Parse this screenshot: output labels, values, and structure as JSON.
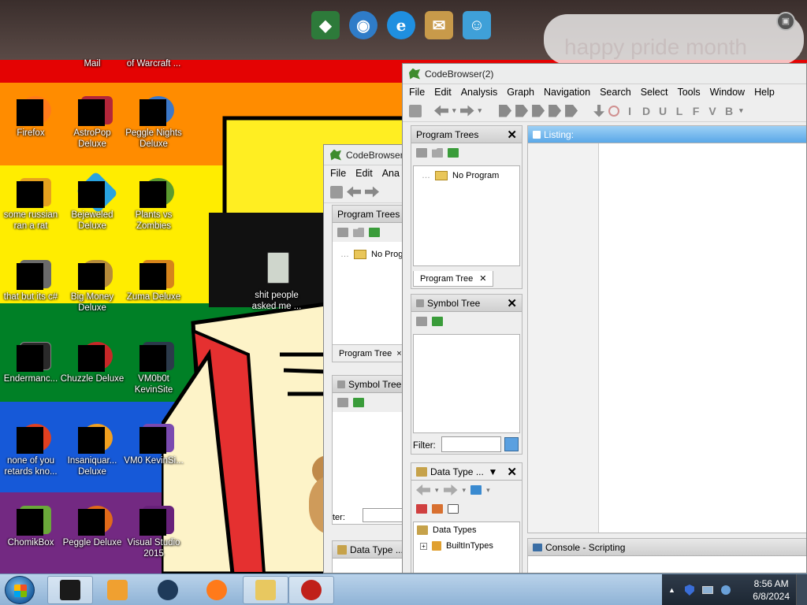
{
  "desktop": {
    "banner_text": "happy pride month",
    "top_labels": [
      {
        "text": "Mail"
      },
      {
        "text": "of Warcraft ..."
      }
    ],
    "icons": [
      {
        "name": "firefox",
        "label": "Firefox",
        "color": "#ff7a1a"
      },
      {
        "name": "astropop",
        "label": "AstroPop Deluxe",
        "color": "#b3263a"
      },
      {
        "name": "peggle-nights",
        "label": "Peggle Nights Deluxe",
        "color": "#3c78c8"
      },
      {
        "name": "some-russian",
        "label": "some russian ran a rat",
        "color": "#e7a21e"
      },
      {
        "name": "bejeweled",
        "label": "Bejeweled Deluxe",
        "color": "#29a3e0"
      },
      {
        "name": "plants-vs-zombies",
        "label": "Plants vs Zombies",
        "color": "#5b9a2e"
      },
      {
        "name": "that-but-its-csharp",
        "label": "that but its c#",
        "color": "#6a6a6a"
      },
      {
        "name": "big-money",
        "label": "Big Money Deluxe",
        "color": "#b58b3a"
      },
      {
        "name": "zuma",
        "label": "Zuma Deluxe",
        "color": "#d6841b"
      },
      {
        "name": "endermanch",
        "label": "Endermanc...",
        "color": "#2a2a2a"
      },
      {
        "name": "chuzzle",
        "label": "Chuzzle Deluxe",
        "color": "#c62828"
      },
      {
        "name": "vm0b0t-kevinsite",
        "label": "VM0b0t KevinSite",
        "color": "#2b3a4a"
      },
      {
        "name": "none-of-you",
        "label": "none of you retards kno...",
        "color": "#e04020"
      },
      {
        "name": "insaniquarium",
        "label": "Insaniquar... Deluxe",
        "color": "#f0a020"
      },
      {
        "name": "vm0-kevinsite",
        "label": "VM0 KevinSi...",
        "color": "#7a4ab0"
      },
      {
        "name": "chomikbox",
        "label": "ChomikBox",
        "color": "#6aa83a"
      },
      {
        "name": "peggle-deluxe",
        "label": "Peggle Deluxe",
        "color": "#e06a1a"
      },
      {
        "name": "visual-studio-2015",
        "label": "Visual Studio 2015",
        "color": "#68217a"
      }
    ],
    "folder_label": "shit people asked me ...",
    "dock": [
      {
        "name": "winamp-icon",
        "glyph": "◆",
        "color": "#2d7a3a"
      },
      {
        "name": "network-globe-icon",
        "glyph": "◉",
        "color": "#2f7cc8"
      },
      {
        "name": "internet-explorer-icon",
        "glyph": "e",
        "color": "#1f8fe0"
      },
      {
        "name": "mail-delivery-icon",
        "glyph": "✉",
        "color": "#c89a4a"
      },
      {
        "name": "users-icon",
        "glyph": "☺",
        "color": "#3fa0d8"
      }
    ]
  },
  "main_window": {
    "title": "CodeBrowser(2)",
    "menu": [
      "File",
      "Edit",
      "Analysis",
      "Graph",
      "Navigation",
      "Search",
      "Select",
      "Tools",
      "Window",
      "Help"
    ],
    "toolbar_letters": [
      "I",
      "D",
      "U",
      "L",
      "F",
      "V",
      "B"
    ],
    "program_trees": {
      "title": "Program Trees",
      "root": "No Program",
      "tab": "Program Tree"
    },
    "symbol_tree": {
      "title": "Symbol Tree"
    },
    "filter_label": "Filter:",
    "data_type_manager": {
      "title": "Data Type ...",
      "root": "Data Types",
      "child": "BuiltInTypes"
    },
    "listing": {
      "title": "Listing:"
    },
    "console": {
      "title": "Console - Scripting"
    }
  },
  "back_window": {
    "title": "CodeBrowser",
    "menu": [
      "File",
      "Edit",
      "Ana"
    ],
    "program_trees": {
      "title": "Program Trees",
      "root": "No Prog",
      "tab": "Program Tree"
    },
    "symbol_tree": {
      "title": "Symbol Tree"
    },
    "filter_label": "ter:",
    "data_type_manager": {
      "title": "Data Type ..."
    }
  },
  "taskbar": {
    "time": "8:56 AM",
    "date": "6/8/2024",
    "items": [
      {
        "name": "taskbar-terminal",
        "color": "#1a1a1a",
        "active": true
      },
      {
        "name": "taskbar-media-player",
        "color": "#f0a030",
        "active": false
      },
      {
        "name": "taskbar-globe-app",
        "color": "#1e3a5a",
        "active": false
      },
      {
        "name": "taskbar-firefox",
        "color": "#ff7a1a",
        "active": false
      },
      {
        "name": "taskbar-file-explorer",
        "color": "#e8c860",
        "active": true
      },
      {
        "name": "taskbar-ghidra",
        "color": "#c0201a",
        "active": true
      }
    ]
  }
}
